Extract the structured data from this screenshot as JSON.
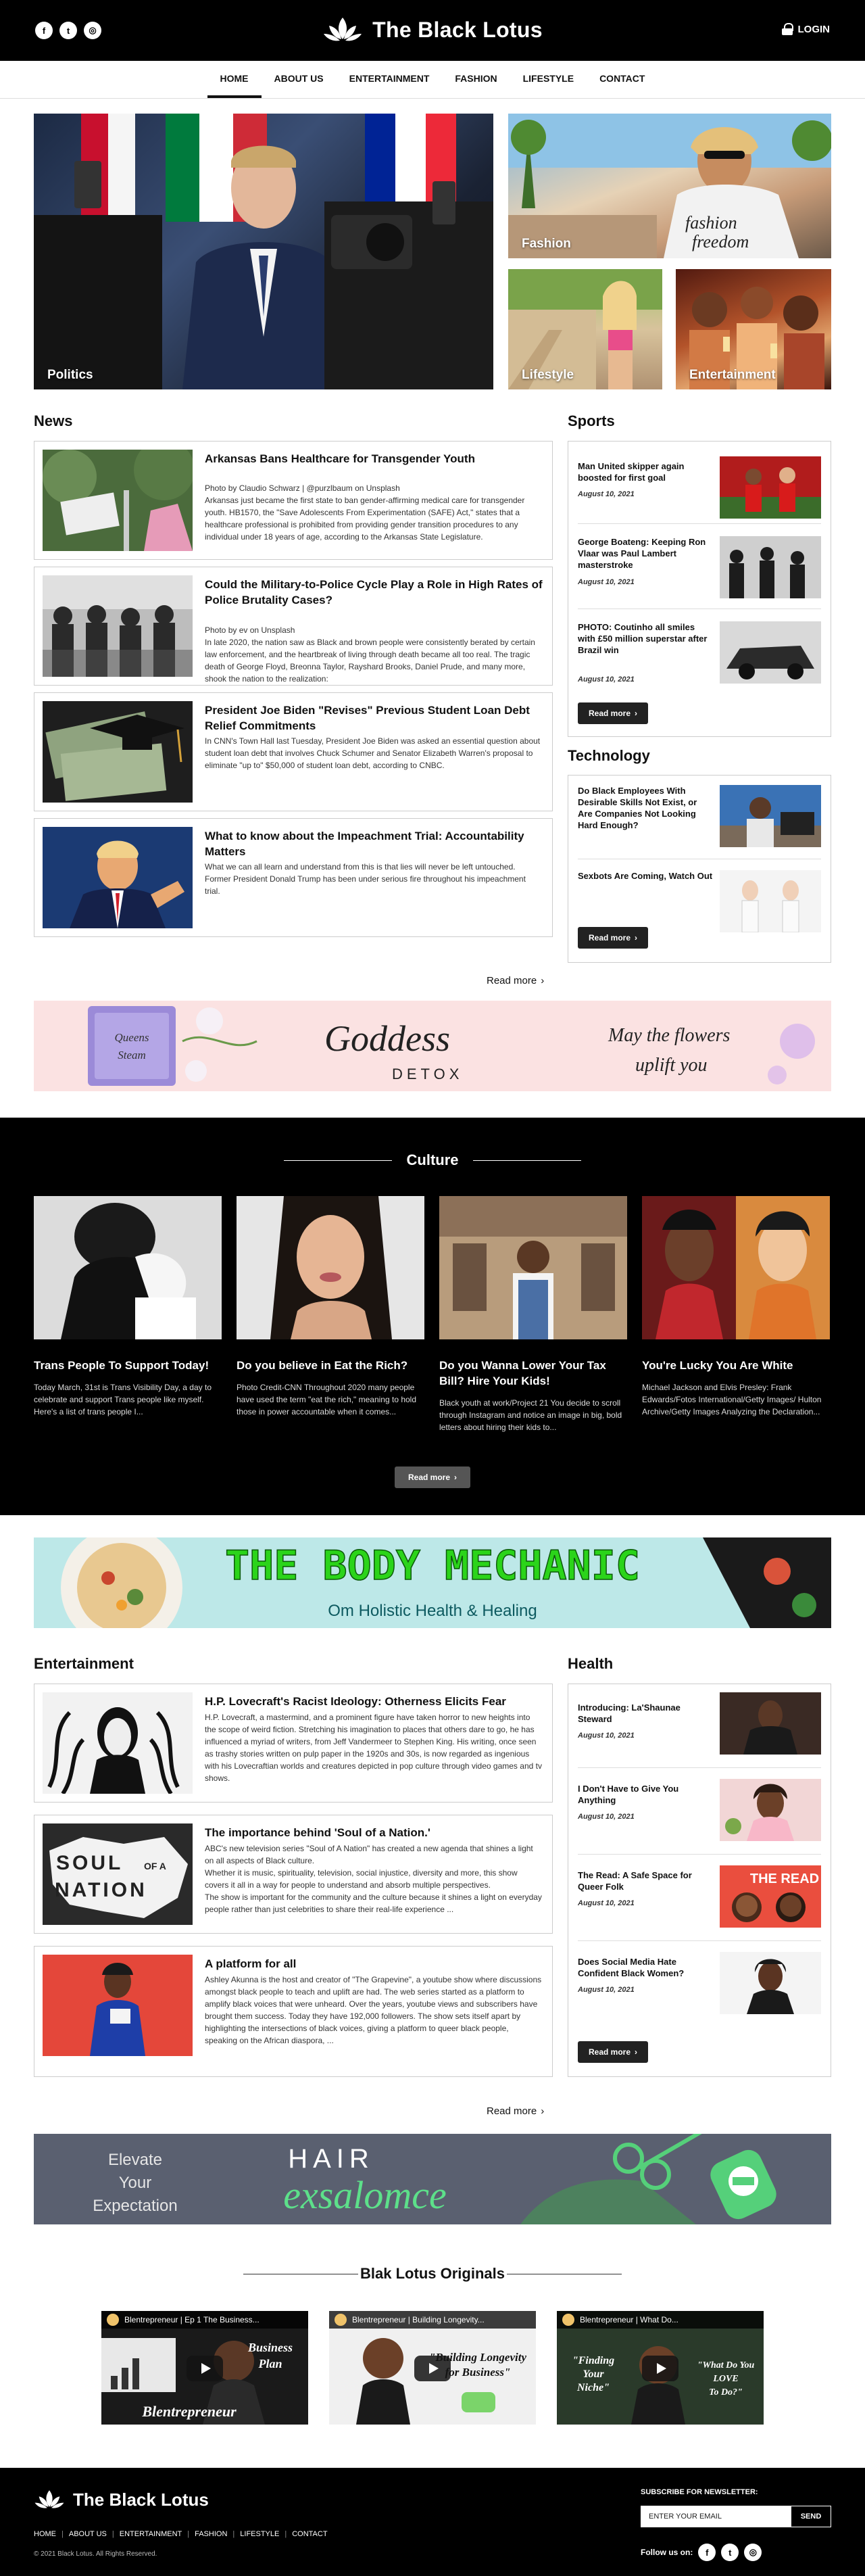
{
  "header": {
    "site_name": "The Black Lotus",
    "social": [
      "f",
      "t",
      "◎"
    ],
    "social_icons": [
      "facebook-icon",
      "twitter-icon",
      "instagram-icon"
    ],
    "login_label": "LOGIN"
  },
  "nav": {
    "items": [
      {
        "label": "HOME",
        "active": true
      },
      {
        "label": "ABOUT US"
      },
      {
        "label": "ENTERTAINMENT"
      },
      {
        "label": "FASHION"
      },
      {
        "label": "LIFESTYLE"
      },
      {
        "label": "CONTACT"
      }
    ]
  },
  "hero": {
    "tiles": [
      {
        "label": "Politics"
      },
      {
        "label": "Fashion"
      },
      {
        "label": "Lifestyle"
      },
      {
        "label": "Entertainment"
      }
    ],
    "shirt_text": "fashion freedom"
  },
  "news": {
    "title": "News",
    "articles": [
      {
        "headline": "Arkansas Bans Healthcare for Transgender Youth",
        "body": "Photo by Claudio Schwarz | @purzlbaum on Unsplash\nArkansas just became the first state to ban gender-affirming medical care for transgender youth. HB1570, the \"Save Adolescents From Experimentation (SAFE) Act,\" states that a healthcare professional is prohibited from providing gender transition procedures to any individual under 18 years of age, according to the Arkansas State Legislature."
      },
      {
        "headline": "Could the Military-to-Police Cycle Play a Role in High Rates of Police Brutality Cases?",
        "body": "Photo by ev on Unsplash\nIn late 2020, the nation saw as Black and brown people were consistently berated by certain law enforcement, and the heartbreak of living through death became all too real. The tragic death of George Floyd, Breonna Taylor, Rayshard Brooks, Daniel Prude, and many more, shook the nation to the realization:"
      },
      {
        "headline": "President Joe Biden \"Revises\" Previous Student Loan Debt Relief Commitments",
        "body": "In CNN's Town Hall last Tuesday, President Joe Biden was asked an essential question about student loan debt that involves Chuck Schumer and Senator Elizabeth Warren's proposal to eliminate \"up to\" $50,000 of student loan debt, according to CNBC."
      },
      {
        "headline": "What to know about the Impeachment Trial: Accountability Matters",
        "body": "What we can all learn and understand from this is that lies will never be left untouched. Former President Donald Trump has been under serious fire throughout his impeachment trial."
      }
    ],
    "read_more": "Read more"
  },
  "sports": {
    "title": "Sports",
    "items": [
      {
        "headline": "Man United skipper again boosted for first goal",
        "date": "August 10, 2021"
      },
      {
        "headline": "George Boateng: Keeping Ron Vlaar was Paul Lambert masterstroke",
        "date": "August 10, 2021"
      },
      {
        "headline": "PHOTO: Coutinho all smiles with £50 million superstar after Brazil win",
        "date": "August 10, 2021"
      }
    ],
    "read_more": "Read more"
  },
  "technology": {
    "title": "Technology",
    "items": [
      {
        "headline": "Do Black Employees With Desirable Skills Not Exist, or Are Companies Not Looking Hard Enough?"
      },
      {
        "headline": "Sexbots Are Coming, Watch Out"
      }
    ],
    "read_more": "Read more"
  },
  "banner_goddess": {
    "title": "Goddess",
    "subtitle": "DETOX",
    "tagline_1": "May the flowers",
    "tagline_2": "uplift you",
    "jar_text_1": "Queens",
    "jar_text_2": "Steam"
  },
  "culture": {
    "title": "Culture",
    "cards": [
      {
        "headline": "Trans People To Support Today!",
        "body": "Today March, 31st is Trans Visibility Day, a day to celebrate and support Trans people like myself. Here's a list of trans people I..."
      },
      {
        "headline": "Do you believe in Eat the Rich?",
        "body": "Photo Credit-CNN Throughout 2020 many people have used the term \"eat the rich,\" meaning to hold those in power accountable when it comes..."
      },
      {
        "headline": "Do you Wanna Lower Your Tax Bill? Hire Your Kids!",
        "body": "Black youth at work/Project 21 You decide to scroll through Instagram and notice an image in big, bold letters about hiring their kids to..."
      },
      {
        "headline": "You're Lucky You Are White",
        "body": "Michael Jackson and Elvis Presley: Frank Edwards/Fotos International/Getty Images/ Hulton Archive/Getty Images Analyzing the Declaration..."
      }
    ],
    "read_more": "Read more"
  },
  "banner_mechanic": {
    "title": "THE BODY MECHANIC",
    "subtitle": "Om Holistic Health & Healing"
  },
  "entertainment": {
    "title": "Entertainment",
    "articles": [
      {
        "headline": "H.P. Lovecraft's Racist Ideology: Otherness Elicits Fear",
        "body": "H.P. Lovecraft, a mastermind, and a prominent figure have taken horror to new heights into the scope of weird fiction. Stretching his imagination to places that others dare to go, he has influenced a myriad of writers, from Jeff Vandermeer to Stephen King. His writing, once seen as trashy stories written on pulp paper in the 1920s and 30s, is now regarded as ingenious with his Lovecraftian worlds and creatures depicted in pop culture through video games and tv shows."
      },
      {
        "headline": "The importance behind 'Soul of a Nation.'",
        "body": "ABC's new television series \"Soul of A Nation\" has created a new agenda that shines a light on all aspects of Black culture.\nWhether it is music, spirituality, television, social injustice, diversity and more, this show covers it all in a way for people to understand and absorb multiple perspectives.\nThe show is important for the community and the culture because it shines a light on everyday people rather than just celebrities to share their real-life experience ..."
      },
      {
        "headline": "A platform for all",
        "body": "Ashley Akunna is the host and creator of \"The Grapevine\", a youtube show where discussions amongst black people to teach and uplift are had. The web series started as a platform to amplify black voices that were unheard. Over the years, youtube views and subscribers have brought them success. Today they have 192,000 followers. The show sets itself apart by highlighting the intersections of black voices, giving a platform to queer black people, speaking on the African diaspora, ..."
      }
    ],
    "soul_text": [
      "SOUL",
      "OF A",
      "NATION"
    ],
    "read_more": "Read more"
  },
  "health": {
    "title": "Health",
    "items": [
      {
        "headline": "Introducing: La'Shaunae Steward",
        "date": "August 10, 2021"
      },
      {
        "headline": "I Don't Have to Give You Anything",
        "date": "August 10, 2021"
      },
      {
        "headline": "The Read: A Safe Space for Queer Folk",
        "date": "August 10, 2021"
      },
      {
        "headline": "Does Social Media Hate Confident Black Women?",
        "date": "August 10, 2021"
      }
    ],
    "the_read_label": "THE READ",
    "read_more": "Read more"
  },
  "banner_hair": {
    "left": [
      "Elevate",
      "Your",
      "Expectation"
    ],
    "brand_top": "HAIR",
    "brand_bottom": "exsalomce"
  },
  "originals": {
    "title": "Blak Lotus Originals",
    "videos": [
      {
        "channel": "Blentrepreneur | Ep 1 The Business..."
      },
      {
        "channel": "Blentrepreneur | Building Longevity..."
      },
      {
        "channel": "Blentrepreneur | What Do..."
      }
    ]
  },
  "footer": {
    "site_name": "The Black Lotus",
    "links": [
      "HOME",
      "ABOUT US",
      "ENTERTAINMENT",
      "FASHION",
      "LIFESTYLE",
      "CONTACT"
    ],
    "copyright": "© 2021 Black Lotus. All Rights Reserved.",
    "newsletter_label": "SUBSCRIBE FOR NEWSLETTER:",
    "email_placeholder": "ENTER YOUR EMAIL",
    "send_label": "SEND",
    "follow_label": "Follow us on:"
  },
  "colors": {
    "header_bg": "#000000",
    "mechanic_green": "#2bd41a",
    "mechanic_bg": "#b7e6e6",
    "hair_bg": "#585f6f",
    "goddess_bg": "#fbdede"
  }
}
